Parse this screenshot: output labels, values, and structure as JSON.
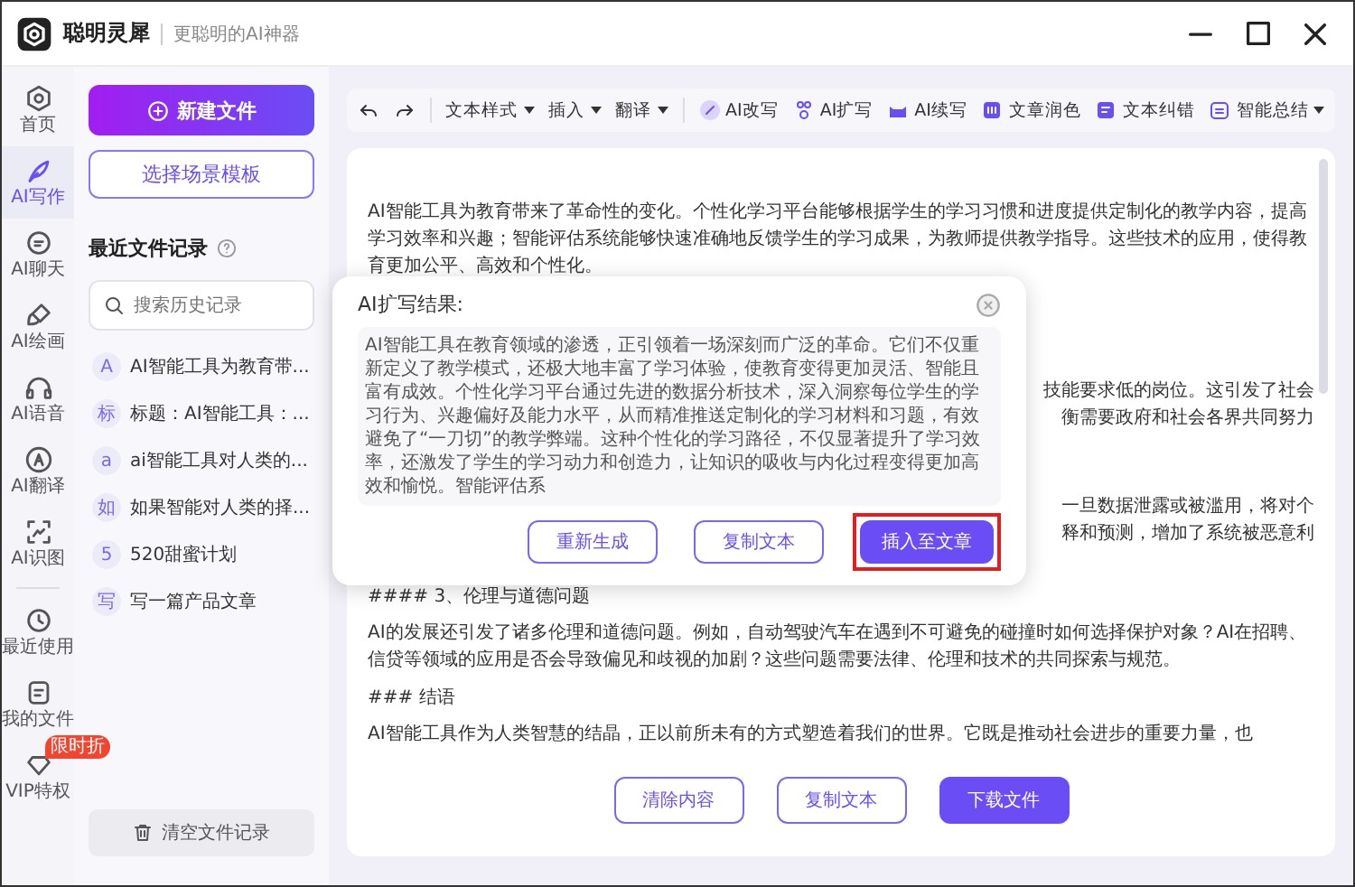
{
  "app": {
    "name": "聪明灵犀",
    "tagline": "更聪明的AI神器"
  },
  "nav": [
    {
      "label": "首页",
      "selected": false
    },
    {
      "label": "AI写作",
      "selected": true
    },
    {
      "label": "AI聊天",
      "selected": false
    },
    {
      "label": "AI绘画",
      "selected": false
    },
    {
      "label": "AI语音",
      "selected": false
    },
    {
      "label": "AI翻译",
      "selected": false
    },
    {
      "label": "AI识图",
      "selected": false
    }
  ],
  "nav_bottom": [
    {
      "label": "最近使用",
      "selected": false
    },
    {
      "label": "我的文件",
      "selected": false
    },
    {
      "label": "VIP特权",
      "selected": false,
      "badge": "限时折"
    }
  ],
  "files_panel": {
    "new_button": "新建文件",
    "template_button": "选择场景模板",
    "recent_title": "最近文件记录",
    "search": {
      "placeholder": "搜索历史记录"
    },
    "files": [
      {
        "mark": "A",
        "title": "AI智能工具为教育带..."
      },
      {
        "mark": "标",
        "title": "标题：AI智能工具：..."
      },
      {
        "mark": "a",
        "title": "ai智能工具对人类的..."
      },
      {
        "mark": "如",
        "title": "如果智能对人类的择..."
      },
      {
        "mark": "5",
        "title": "520甜蜜计划"
      },
      {
        "mark": "写",
        "title": "写一篇产品文章"
      }
    ],
    "clear_button": "清空文件记录"
  },
  "toolbar": [
    {
      "label": "文本样式",
      "kind": "menu"
    },
    {
      "label": "插入",
      "kind": "menu"
    },
    {
      "label": "翻译",
      "kind": "menu"
    },
    {
      "label": "AI改写",
      "kind": "tool"
    },
    {
      "label": "AI扩写",
      "kind": "tool"
    },
    {
      "label": "AI续写",
      "kind": "tool"
    },
    {
      "label": "文章润色",
      "kind": "tool"
    },
    {
      "label": "文本纠错",
      "kind": "tool"
    },
    {
      "label": "智能总结",
      "kind": "tool-menu"
    }
  ],
  "editor": {
    "blocks": [
      {
        "kind": "paragraph",
        "text": "AI智能工具为教育带来了革命性的变化。个性化学习平台能够根据学生的学习习惯和进度提供定制化的教学内容，提高学习效率和兴趣；智能评估系统能够快速准确地反馈学生的学习成果，为教师提供教学指导。这些技术的应用，使得教育更加公平、高效和个性化。"
      },
      {
        "kind": "fragment",
        "lines": [
          "技能要求低的岗位。这引发了社会",
          "衡需要政府和社会各界共同努力"
        ]
      },
      {
        "kind": "fragment",
        "lines": [
          "一旦数据泄露或被滥用，将对个",
          "释和预测，增加了系统被恶意利"
        ]
      },
      {
        "kind": "heading",
        "text": "#### 3、伦理与道德问题"
      },
      {
        "kind": "paragraph",
        "text": "AI的发展还引发了诸多伦理和道德问题。例如，自动驾驶汽车在遇到不可避免的碰撞时如何选择保护对象？AI在招聘、信贷等领域的应用是否会导致偏见和歧视的加剧？这些问题需要法律、伦理和技术的共同探索与规范。"
      },
      {
        "kind": "heading",
        "text": "### 结语"
      },
      {
        "kind": "paragraph",
        "text": "AI智能工具作为人类智慧的结晶，正以前所未有的方式塑造着我们的世界。它既是推动社会进步的重要力量，也"
      }
    ],
    "buttons": [
      {
        "label": "清除内容",
        "kind": "outline"
      },
      {
        "label": "复制文本",
        "kind": "outline"
      },
      {
        "label": "下载文件",
        "kind": "primary"
      }
    ]
  },
  "dialog": {
    "title": "AI扩写结果:",
    "text": "AI智能工具在教育领域的渗透，正引领着一场深刻而广泛的革命。它们不仅重新定义了教学模式，还极大地丰富了学习体验，使教育变得更加灵活、智能且富有成效。个性化学习平台通过先进的数据分析技术，深入洞察每位学生的学习行为、兴趣偏好及能力水平，从而精准推送定制化的学习材料和习题，有效避免了“一刀切”的教学弊端。这种个性化的学习路径，不仅显著提升了学习效率，还激发了学生的学习动力和创造力，让知识的吸收与内化过程变得更加高效和愉悦。智能评估系",
    "buttons": [
      {
        "label": "重新生成",
        "kind": "outline",
        "highlighted": false
      },
      {
        "label": "复制文本",
        "kind": "outline",
        "highlighted": false
      },
      {
        "label": "插入至文章",
        "kind": "primary",
        "highlighted": true
      }
    ]
  }
}
